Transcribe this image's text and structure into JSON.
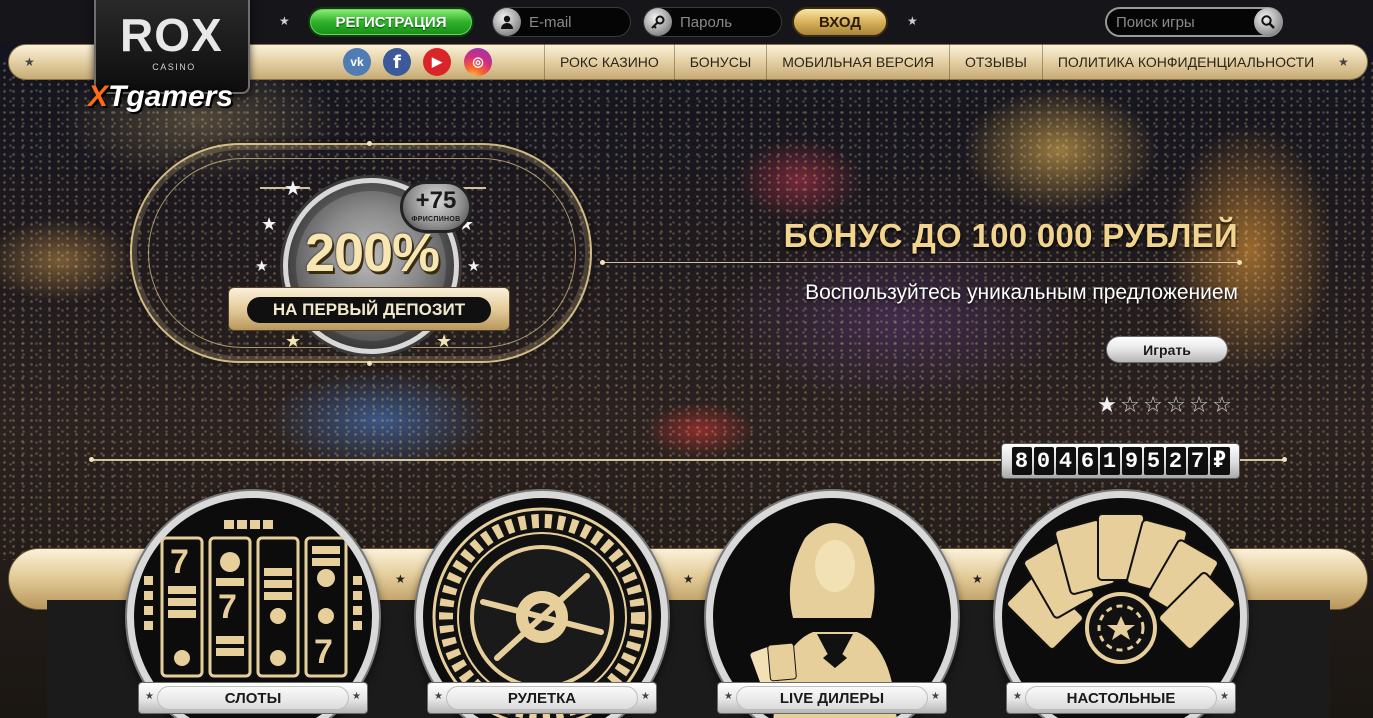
{
  "brand": {
    "name": "ROX",
    "sub": "CASINO",
    "partner": "XTgamers"
  },
  "header": {
    "register_label": "РЕГИСТРАЦИЯ",
    "email_placeholder": "E-mail",
    "password_placeholder": "Пароль",
    "login_label": "ВХОД",
    "search_placeholder": "Поиск игры"
  },
  "social": {
    "vk": "vk",
    "fb": "f",
    "yt": "▶",
    "ig": "◎"
  },
  "nav": {
    "items": [
      {
        "label": "РОКС КАЗИНО"
      },
      {
        "label": "БОНУСЫ"
      },
      {
        "label": "МОБИЛЬНАЯ ВЕРСИЯ"
      },
      {
        "label": "ОТЗЫВЫ"
      },
      {
        "label": "ПОЛИТИКА КОНФИДЕНЦИАЛЬНОСТИ"
      }
    ]
  },
  "promo": {
    "free_spins_value": "+75",
    "free_spins_label": "ФРИСПИНОВ",
    "percent": "200%",
    "deposit_label": "НА ПЕРВЫЙ ДЕПОЗИТ",
    "title": "БОНУС ДО 100 000 РУБЛЕЙ",
    "subtitle": "Воспользуйтесь уникальным предложением",
    "play_label": "Играть",
    "rating": {
      "filled": 1,
      "total": 6
    }
  },
  "jackpot": {
    "digits": [
      "8",
      "0",
      "4",
      "6",
      "1",
      "9",
      "5",
      "2",
      "7",
      "₽"
    ]
  },
  "categories": [
    {
      "label": "СЛОТЫ",
      "icon": "slots-icon"
    },
    {
      "label": "РУЛЕТКА",
      "icon": "roulette-icon"
    },
    {
      "label": "LIVE ДИЛЕРЫ",
      "icon": "dealer-icon"
    },
    {
      "label": "НАСТОЛЬНЫЕ",
      "icon": "cards-icon"
    }
  ],
  "colors": {
    "register_green": "#2fb12a",
    "gold": "#d8b15a",
    "title_gold": "#f1d48e"
  }
}
